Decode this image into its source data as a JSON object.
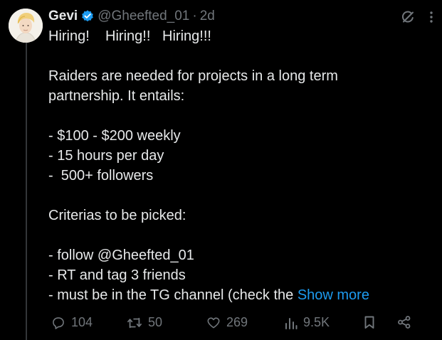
{
  "author": {
    "name": "Gevi",
    "handle": "@Gheefted_01",
    "separator": "·",
    "time": "2d"
  },
  "icons": {
    "avatar": "avatar",
    "verified": "verified-badge-icon",
    "grok": "grok-icon",
    "more": "more-options-icon"
  },
  "content": {
    "line1": "Hiring!    Hiring!!   Hiring!!!",
    "line2": "",
    "line3": "Raiders are needed for projects in a long term",
    "line4": "partnership. It entails:",
    "line5": "",
    "line6": "- $100 - $200 weekly",
    "line7": "- 15 hours per day",
    "line8": "-  500+ followers",
    "line9": "",
    "line10": "Criterias to be picked:",
    "line11": "",
    "line12": "- follow @Gheefted_01",
    "line13": "- RT and tag 3 friends",
    "line14": "- must be in the TG channel (check the ",
    "show_more": "Show more"
  },
  "actions": {
    "replies": "104",
    "reposts": "50",
    "likes": "269",
    "views": "9.5K"
  },
  "colors": {
    "background": "#000000",
    "text": "#e7e9ea",
    "muted": "#71767b",
    "link": "#1d9bf0",
    "verified": "#1d9bf0"
  }
}
